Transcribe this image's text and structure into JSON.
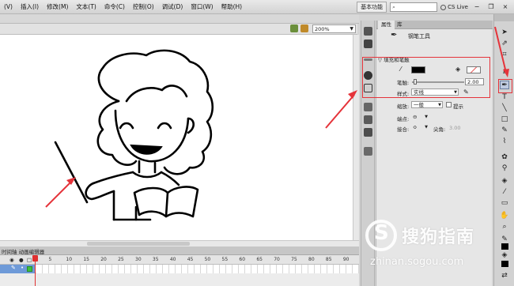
{
  "menubar": {
    "items": [
      "(V)",
      "插入(I)",
      "修改(M)",
      "文本(T)",
      "命令(C)",
      "控制(O)",
      "调试(D)",
      "窗口(W)",
      "帮助(H)"
    ],
    "workspace": "基本功能",
    "search_placeholder": "",
    "cs_live": "CS Live",
    "minimize": "−",
    "restore": "❐",
    "close": "×"
  },
  "stage": {
    "zoom": "200%"
  },
  "timeline": {
    "tab_label": "时间轴  动画编辑器",
    "frame_numbers": [
      "1",
      "5",
      "10",
      "15",
      "20",
      "25",
      "30",
      "35",
      "40",
      "45",
      "50",
      "55",
      "60",
      "65",
      "70",
      "75",
      "80",
      "85",
      "90"
    ]
  },
  "properties": {
    "tabs": [
      "属性",
      "库"
    ],
    "tool_name": "钢笔工具",
    "section_fill_stroke": "▽ 填充和笔触",
    "stroke_label": "笔触:",
    "stroke_value": "2.00",
    "style_label": "样式:",
    "style_value": "实线",
    "scale_label": "缩放:",
    "scale_value": "一般",
    "hint_label": "提示",
    "cap_label": "端点:",
    "join_label": "接合:",
    "miter_label": "尖角:",
    "miter_value": "3.00"
  },
  "watermark": {
    "brand": "搜狗指南",
    "url": "zhinan.sogou.com"
  },
  "colors": {
    "highlight": "#e5333a",
    "stroke_swatch": "#000000",
    "layer_selected": "#6e9ad8"
  }
}
